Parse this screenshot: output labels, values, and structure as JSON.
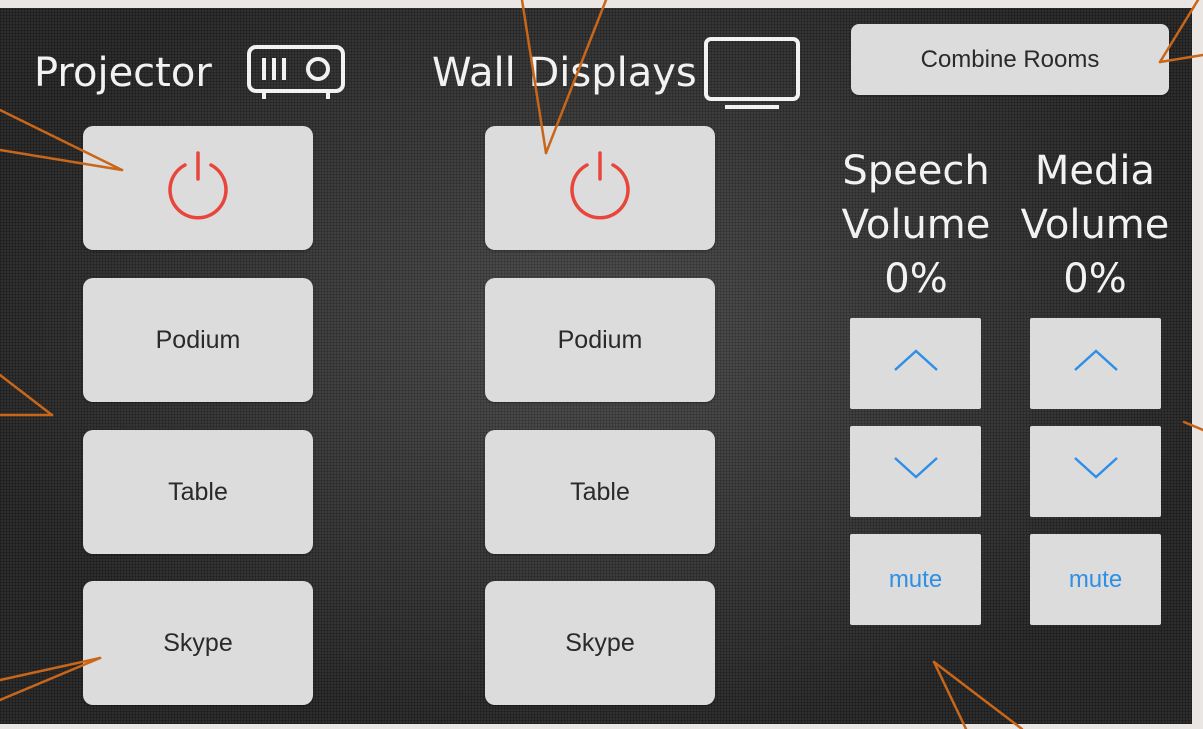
{
  "projector": {
    "title": "Projector",
    "icon": "projector-icon",
    "buttons": [
      "Podium",
      "Table",
      "Skype"
    ]
  },
  "wall_displays": {
    "title": "Wall Displays",
    "icon": "monitor-icon",
    "buttons": [
      "Podium",
      "Table",
      "Skype"
    ]
  },
  "combine_rooms_label": "Combine Rooms",
  "speech_volume": {
    "line1": "Speech",
    "line2": "Volume",
    "level": "0%",
    "mute_label": "mute"
  },
  "media_volume": {
    "line1": "Media",
    "line2": "Volume",
    "level": "0%",
    "mute_label": "mute"
  },
  "colors": {
    "power": "#e8463c",
    "accent": "#2e8fe6",
    "annotation": "#c8661a"
  }
}
